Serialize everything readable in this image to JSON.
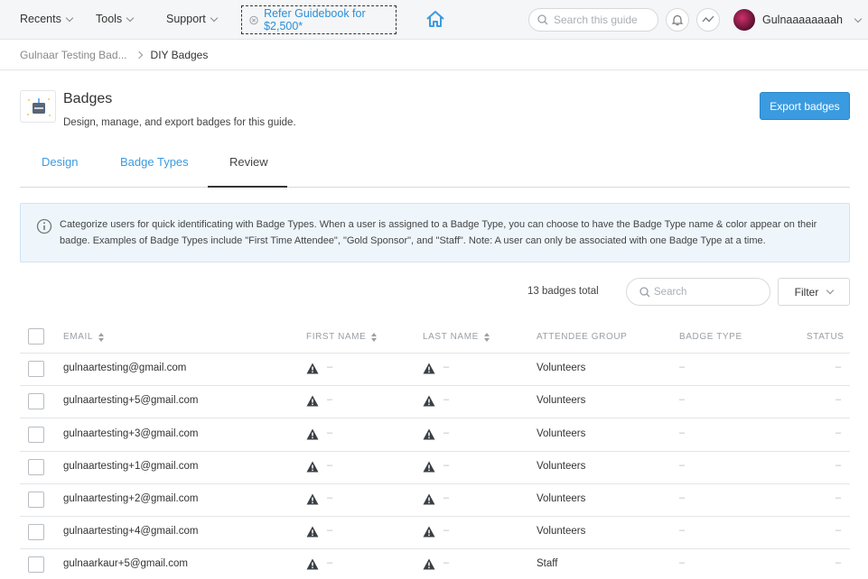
{
  "nav": {
    "recents": "Recents",
    "tools": "Tools",
    "support": "Support",
    "refer": "Refer Guidebook for $2,500*",
    "search_placeholder": "Search this guide",
    "user_name": "Gulnaaaaaaaah"
  },
  "breadcrumb": {
    "parent": "Gulnaar Testing Bad...",
    "current": "DIY Badges"
  },
  "header": {
    "title": "Badges",
    "subtitle": "Design, manage, and export badges for this guide.",
    "export_label": "Export badges"
  },
  "tabs": [
    {
      "label": "Design",
      "active": false
    },
    {
      "label": "Badge Types",
      "active": false
    },
    {
      "label": "Review",
      "active": true
    }
  ],
  "info": {
    "text": "Categorize users for quick identificating with Badge Types. When a user is assigned to a Badge Type, you can choose to have the Badge Type name & color appear on their badge. Examples of Badge Types include \"First Time Attendee\", \"Gold Sponsor\", and \"Staff\". Note: A user can only be associated with one Badge Type at a time."
  },
  "toolbar": {
    "total": "13 badges total",
    "search_placeholder": "Search",
    "filter_label": "Filter"
  },
  "table": {
    "columns": [
      "EMAIL",
      "FIRST NAME",
      "LAST NAME",
      "ATTENDEE GROUP",
      "BADGE TYPE",
      "STATUS"
    ],
    "rows": [
      {
        "email": "gulnaartesting@gmail.com",
        "first": "–",
        "last": "–",
        "group": "Volunteers",
        "badge_type": "–",
        "status": "–"
      },
      {
        "email": "gulnaartesting+5@gmail.com",
        "first": "–",
        "last": "–",
        "group": "Volunteers",
        "badge_type": "–",
        "status": "–"
      },
      {
        "email": "gulnaartesting+3@gmail.com",
        "first": "–",
        "last": "–",
        "group": "Volunteers",
        "badge_type": "–",
        "status": "–"
      },
      {
        "email": "gulnaartesting+1@gmail.com",
        "first": "–",
        "last": "–",
        "group": "Volunteers",
        "badge_type": "–",
        "status": "–"
      },
      {
        "email": "gulnaartesting+2@gmail.com",
        "first": "–",
        "last": "–",
        "group": "Volunteers",
        "badge_type": "–",
        "status": "–"
      },
      {
        "email": "gulnaartesting+4@gmail.com",
        "first": "–",
        "last": "–",
        "group": "Volunteers",
        "badge_type": "–",
        "status": "–"
      },
      {
        "email": "gulnaarkaur+5@gmail.com",
        "first": "–",
        "last": "–",
        "group": "Staff",
        "badge_type": "–",
        "status": "–"
      }
    ]
  },
  "colors": {
    "accent": "#3b9be0",
    "info_bg": "#eef6fc"
  }
}
